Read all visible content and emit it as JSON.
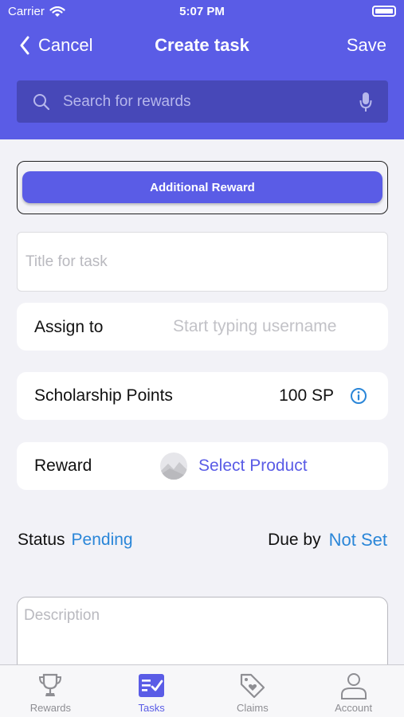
{
  "status_bar": {
    "carrier": "Carrier",
    "time": "5:07 PM"
  },
  "nav": {
    "back_label": "Cancel",
    "title": "Create task",
    "save_label": "Save"
  },
  "search": {
    "placeholder": "Search for rewards"
  },
  "segment": {
    "label": "Additional Reward"
  },
  "form": {
    "title_placeholder": "Title for task",
    "assign_label": "Assign to",
    "assign_placeholder": "Start typing username",
    "points_label": "Scholarship Points",
    "points_value": "100 SP",
    "reward_label": "Reward",
    "reward_link": "Select Product",
    "status_label": "Status",
    "status_value": "Pending",
    "due_label": "Due by",
    "due_value": "Not Set",
    "description_placeholder": "Description"
  },
  "tabbar": {
    "items": [
      {
        "label": "Rewards",
        "icon": "trophy-icon",
        "active": false
      },
      {
        "label": "Tasks",
        "icon": "tasks-checklist-icon",
        "active": true
      },
      {
        "label": "Claims",
        "icon": "tag-heart-icon",
        "active": false
      },
      {
        "label": "Account",
        "icon": "person-icon",
        "active": false
      }
    ]
  },
  "colors": {
    "brand": "#5a5ce6",
    "link_blue": "#2a86d8",
    "background": "#f2f2f7"
  }
}
